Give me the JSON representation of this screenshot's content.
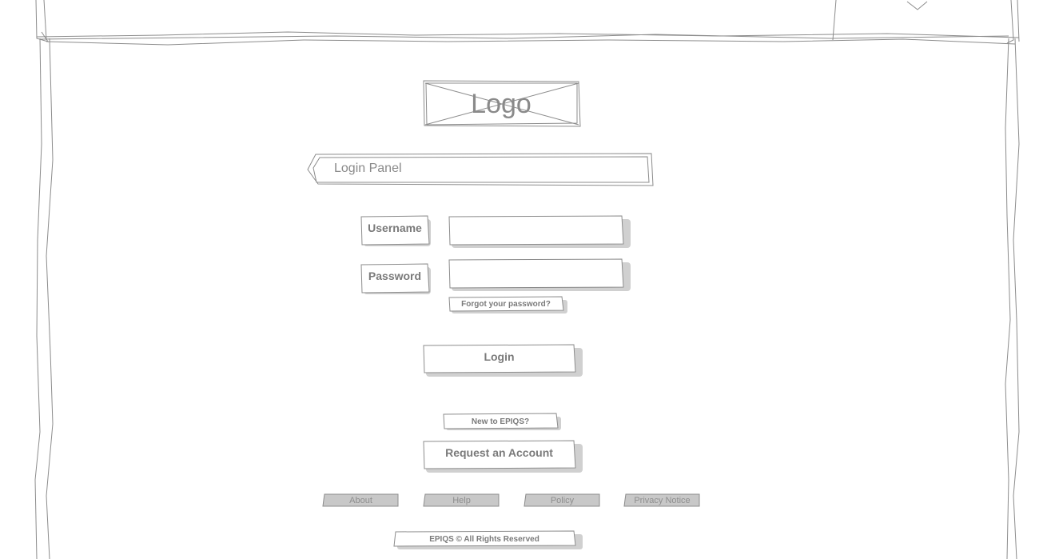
{
  "logo": {
    "label": "Logo"
  },
  "panel": {
    "title": "Login Panel"
  },
  "form": {
    "username_label": "Username",
    "username_value": "",
    "password_label": "Password",
    "password_value": "",
    "forgot_label": "Forgot your password?",
    "login_label": "Login"
  },
  "signup": {
    "prompt": "New to EPIQS?",
    "request_label": "Request an Account"
  },
  "footer": {
    "links": [
      "About",
      "Help",
      "Policy",
      "Privacy Notice"
    ],
    "copyright": "EPIQS © All Rights Reserved"
  },
  "colors": {
    "sketch_stroke": "#8c8c8c",
    "shadow": "#d0d0d0",
    "footer_fill": "#c8c8c8"
  },
  "icons": {
    "header_dropdown": "chevron-down-icon"
  }
}
